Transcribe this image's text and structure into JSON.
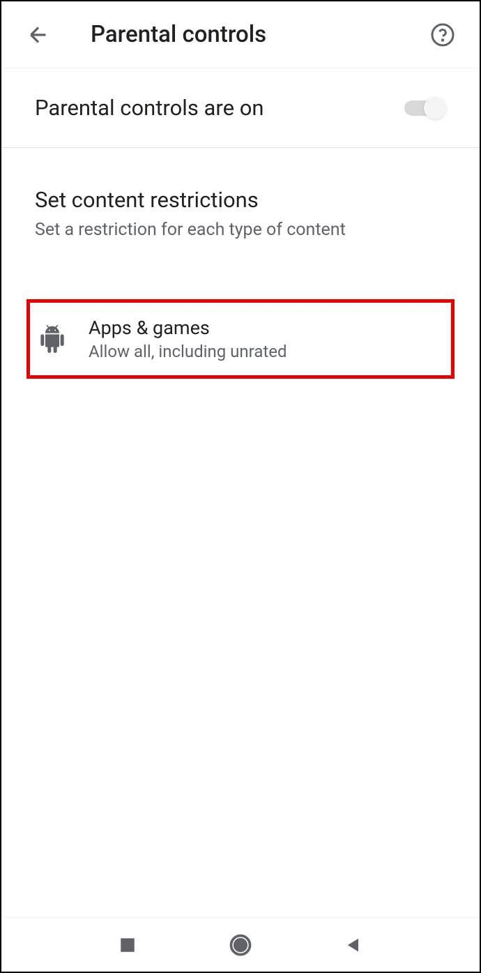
{
  "header": {
    "title": "Parental controls"
  },
  "toggle": {
    "label": "Parental controls are on",
    "state": "on"
  },
  "restrictions": {
    "title": "Set content restrictions",
    "subtitle": "Set a restriction for each type of content"
  },
  "items": [
    {
      "title": "Apps & games",
      "subtitle": "Allow all, including unrated"
    }
  ]
}
